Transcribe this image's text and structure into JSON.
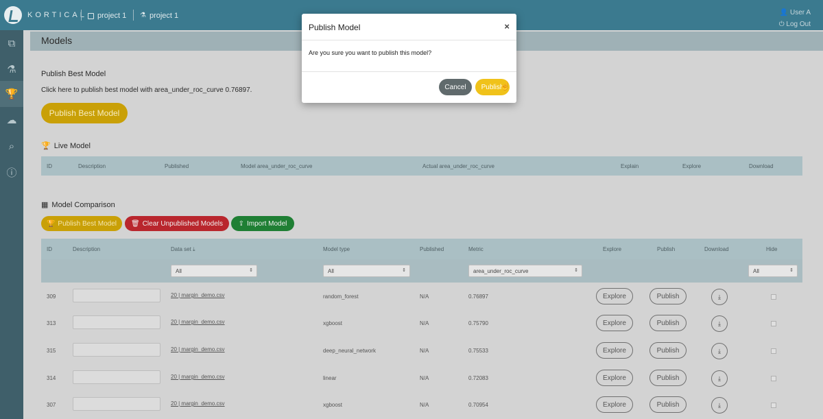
{
  "topbar": {
    "brand": "KORTICAL",
    "crumb1": "project 1",
    "crumb2": "project 1",
    "user": "User A",
    "logout": "Log Out"
  },
  "sidebar": {
    "icons": [
      "copy-icon",
      "flask-icon",
      "trophy-icon",
      "cloud-upload-icon",
      "search-plus-icon",
      "info-icon"
    ],
    "glyphs": [
      "⧉",
      "⚗",
      "🏆",
      "☁",
      "⌕",
      "ⓘ"
    ]
  },
  "page": {
    "title": "Models"
  },
  "publish_best": {
    "title": "Publish Best Model",
    "description": "Click here to publish best model with area_under_roc_curve 0.76897.",
    "button": "Publish Best Model"
  },
  "live_model": {
    "title": "Live Model",
    "columns": [
      "ID",
      "Description",
      "Published",
      "Model area_under_roc_curve",
      "Actual area_under_roc_curve",
      "Explain",
      "Explore",
      "Download"
    ]
  },
  "comparison": {
    "title": "Model Comparison",
    "buttons": {
      "publish_best": "Publish Best Model",
      "clear": "Clear Unpublished Models",
      "import": "Import Model"
    },
    "columns": [
      "ID",
      "Description",
      "Data set",
      "Model type",
      "Published",
      "Metric",
      "Explore",
      "Publish",
      "Download",
      "Hide"
    ],
    "filters": {
      "dataset": "All",
      "model_type": "All",
      "metric": "area_under_roc_curve",
      "hide": "All"
    },
    "rows": [
      {
        "id": "309",
        "dataset": "20 | margin_demo.csv",
        "model_type": "random_forest",
        "published": "N/A",
        "metric": "0.76897",
        "explore": "Explore",
        "publish": "Publish"
      },
      {
        "id": "313",
        "dataset": "20 | margin_demo.csv",
        "model_type": "xgboost",
        "published": "N/A",
        "metric": "0.75790",
        "explore": "Explore",
        "publish": "Publish"
      },
      {
        "id": "315",
        "dataset": "20 | margin_demo.csv",
        "model_type": "deep_neural_network",
        "published": "N/A",
        "metric": "0.75533",
        "explore": "Explore",
        "publish": "Publish"
      },
      {
        "id": "314",
        "dataset": "20 | margin_demo.csv",
        "model_type": "linear",
        "published": "N/A",
        "metric": "0.72083",
        "explore": "Explore",
        "publish": "Publish"
      },
      {
        "id": "307",
        "dataset": "20 | margin_demo.csv",
        "model_type": "xgboost",
        "published": "N/A",
        "metric": "0.70954",
        "explore": "Explore",
        "publish": "Publish"
      }
    ]
  },
  "modal": {
    "title": "Publish Model",
    "close": "×",
    "body": "Are you sure you want to publish this model?",
    "cancel": "Cancel",
    "publish": "Publish"
  },
  "colors": {
    "topbar": "#3b7a8f",
    "sidebar": "#3f5f6a",
    "yellow": "#c9a007",
    "red": "#b9262d",
    "green": "#1f7f34",
    "modal_publish": "#f0c21a",
    "modal_cancel": "#606a6c"
  }
}
